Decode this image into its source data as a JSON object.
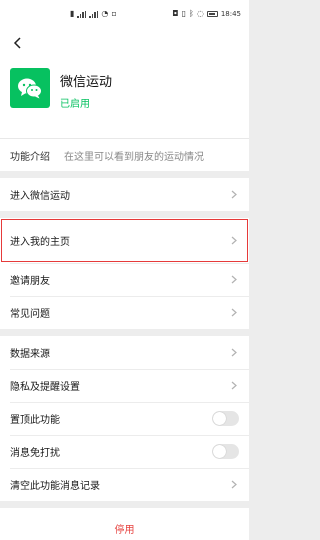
{
  "status_bar": {
    "time": "18:45"
  },
  "header": {
    "app_name": "微信运动",
    "app_status": "已启用",
    "intro_label": "功能介绍",
    "intro_text": "在这里可以看到朋友的运动情况"
  },
  "menu_group_1": [
    {
      "label": "进入微信运动"
    },
    {
      "label": "进入我的主页"
    },
    {
      "label": "邀请朋友"
    },
    {
      "label": "常见问题"
    }
  ],
  "menu_group_2": [
    {
      "label": "数据来源"
    },
    {
      "label": "隐私及提醒设置"
    },
    {
      "label": "置顶此功能",
      "toggle": false
    },
    {
      "label": "消息免打扰",
      "toggle": false
    },
    {
      "label": "清空此功能消息记录"
    }
  ],
  "disable_label": "停用",
  "colors": {
    "accent": "#07c160",
    "danger": "#e64340",
    "highlight": "#e63a3a"
  }
}
